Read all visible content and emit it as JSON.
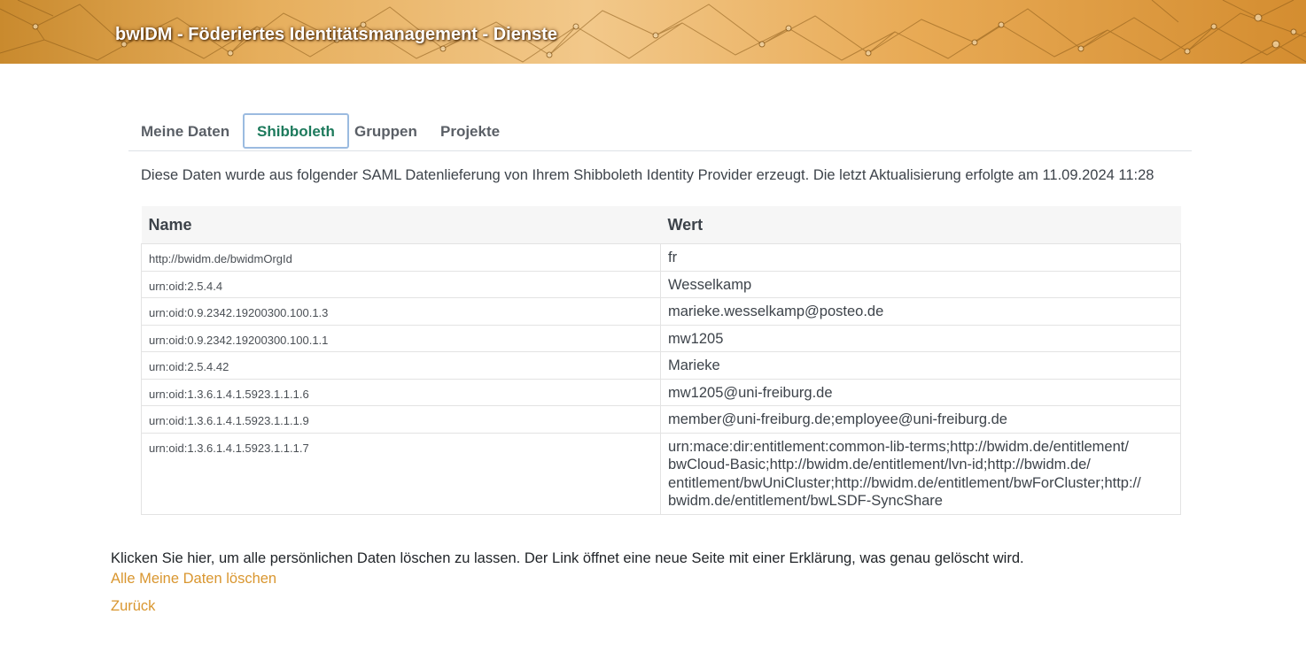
{
  "header": {
    "title": "bwIDM - Föderiertes Identitätsmanagement - Dienste"
  },
  "tabs": [
    {
      "label": "Meine Daten",
      "active": false
    },
    {
      "label": "Shibboleth",
      "active": true
    },
    {
      "label": "Gruppen",
      "active": false
    },
    {
      "label": "Projekte",
      "active": false
    }
  ],
  "intro": "Diese Daten wurde aus folgender SAML Datenlieferung von Ihrem Shibboleth Identity Provider erzeugt. Die letzt Aktualisierung erfolgte am 11.09.2024 11:28",
  "table": {
    "columns": [
      "Name",
      "Wert"
    ],
    "rows": [
      {
        "name": "http://bwidm.de/bwidmOrgId",
        "value": "fr"
      },
      {
        "name": "urn:oid:2.5.4.4",
        "value": "Wesselkamp"
      },
      {
        "name": "urn:oid:0.9.2342.19200300.100.1.3",
        "value": "marieke.wesselkamp@posteo.de"
      },
      {
        "name": "urn:oid:0.9.2342.19200300.100.1.1",
        "value": "mw1205"
      },
      {
        "name": "urn:oid:2.5.4.42",
        "value": "Marieke"
      },
      {
        "name": "urn:oid:1.3.6.1.4.1.5923.1.1.1.6",
        "value": "mw1205@uni-freiburg.de"
      },
      {
        "name": "urn:oid:1.3.6.1.4.1.5923.1.1.1.9",
        "value": "member@uni-freiburg.de;employee@uni-freiburg.de"
      },
      {
        "name": "urn:oid:1.3.6.1.4.1.5923.1.1.1.7",
        "value_lines": [
          "urn:mace:dir:entitlement:common-lib-terms;http://bwidm.de/entitlement/",
          "bwCloud-Basic;http://bwidm.de/entitlement/lvn-id;http://bwidm.de/",
          "entitlement/bwUniCluster;http://bwidm.de/entitlement/bwForCluster;http://",
          "bwidm.de/entitlement/bwLSDF-SyncShare"
        ]
      }
    ]
  },
  "footer": {
    "text": "Klicken Sie hier, um alle persönlichen Daten löschen zu lassen. Der Link öffnet eine neue Seite mit einer Erklärung, was genau gelöscht wird.",
    "delete_link": "Alle Meine Daten löschen",
    "back_link": "Zurück"
  },
  "colors": {
    "accent_link": "#d9962f",
    "active_tab": "#1d7a5c",
    "header_orange": "#e6ae5c"
  }
}
